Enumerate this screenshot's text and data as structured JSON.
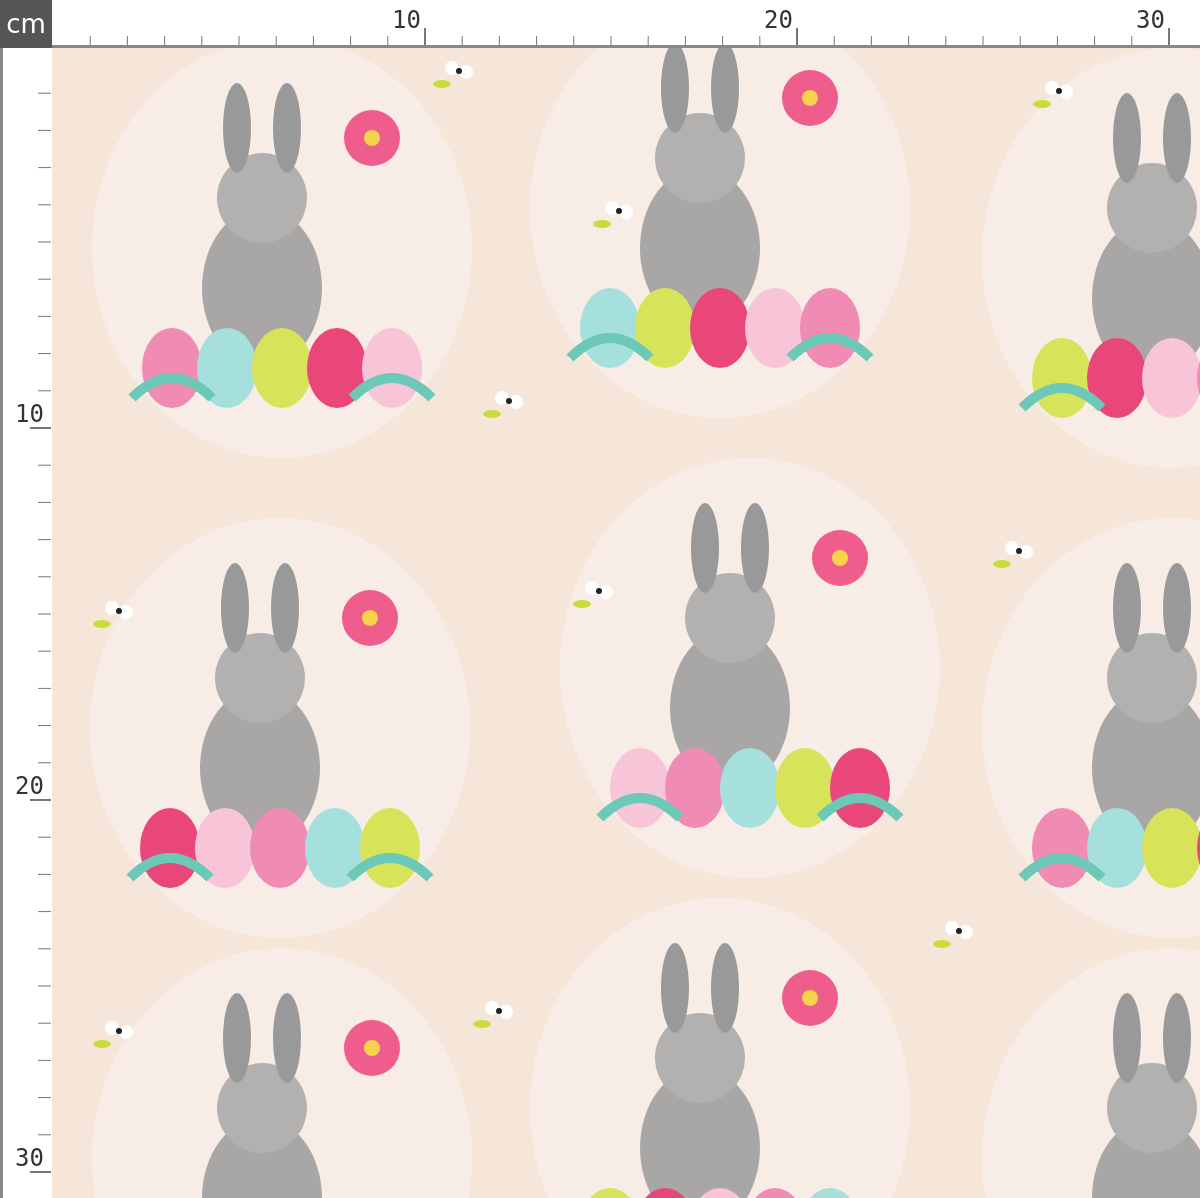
{
  "ruler": {
    "unit": "cm",
    "top_labels": [
      "10",
      "20",
      "30"
    ],
    "left_labels": [
      "10",
      "20",
      "30"
    ]
  },
  "fabric": {
    "kind": "pattern"
  }
}
